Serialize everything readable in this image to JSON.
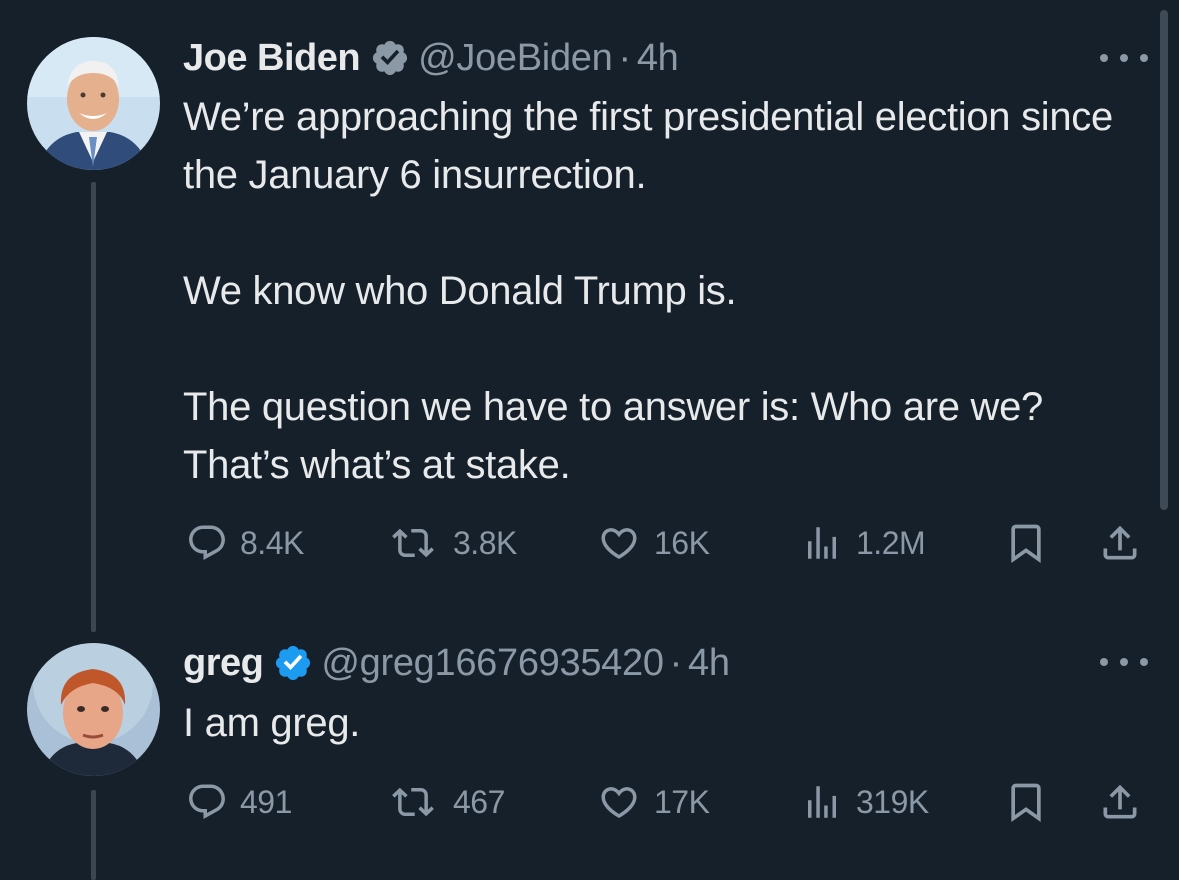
{
  "tweets": [
    {
      "name": "Joe Biden",
      "handle": "@JoeBiden",
      "time": "4h",
      "verified_color": "#8b98a5",
      "avatar": "man-smiling-suit-photo",
      "text": [
        "We’re approaching the first presidential election since the January 6 insurrection.",
        "We know who Donald Trump is.",
        "The question we have to answer is: Who are we? That’s what’s at stake."
      ],
      "replies": "8.4K",
      "retweets": "3.8K",
      "likes": "16K",
      "views": "1.2M"
    },
    {
      "name": "greg",
      "handle": "@greg16676935420",
      "time": "4h",
      "verified_color": "#1d9bf0",
      "avatar": "red-haired-young-man-photo",
      "text": [
        "I am greg."
      ],
      "replies": "491",
      "retweets": "467",
      "likes": "17K",
      "views": "319K"
    }
  ],
  "separator": "·",
  "colors": {
    "background": "#15202b",
    "text": "#e7e9ea",
    "muted": "#8b98a5",
    "blue": "#1d9bf0"
  }
}
